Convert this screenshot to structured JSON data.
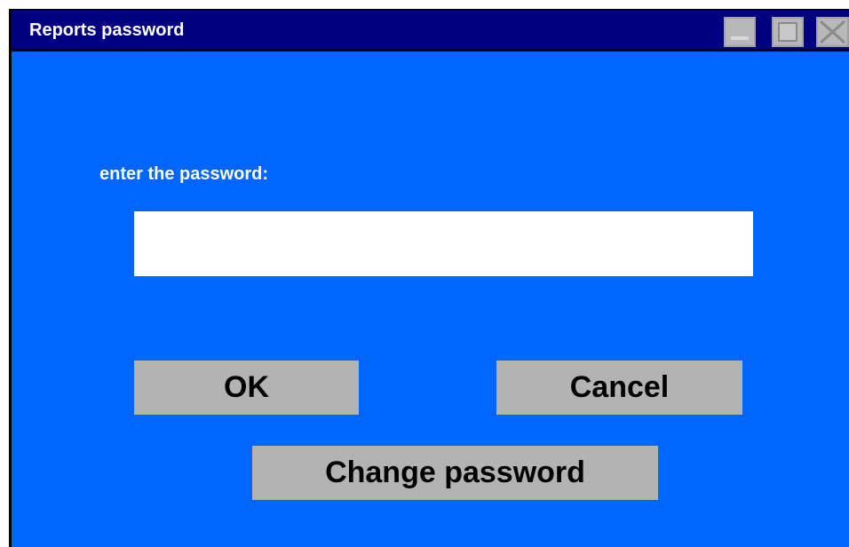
{
  "window": {
    "title": "Reports password",
    "controls": {
      "minimize": "minimize-icon",
      "maximize": "maximize-icon",
      "close": "close-icon"
    }
  },
  "form": {
    "prompt": "enter the password:",
    "password_value": "",
    "password_placeholder": ""
  },
  "buttons": {
    "ok_label": "OK",
    "cancel_label": "Cancel",
    "change_password_label": "Change password"
  },
  "colors": {
    "titlebar": "#000080",
    "window_background": "#0066ff",
    "button_background": "#b3b3b3",
    "input_background": "#ffffff"
  }
}
